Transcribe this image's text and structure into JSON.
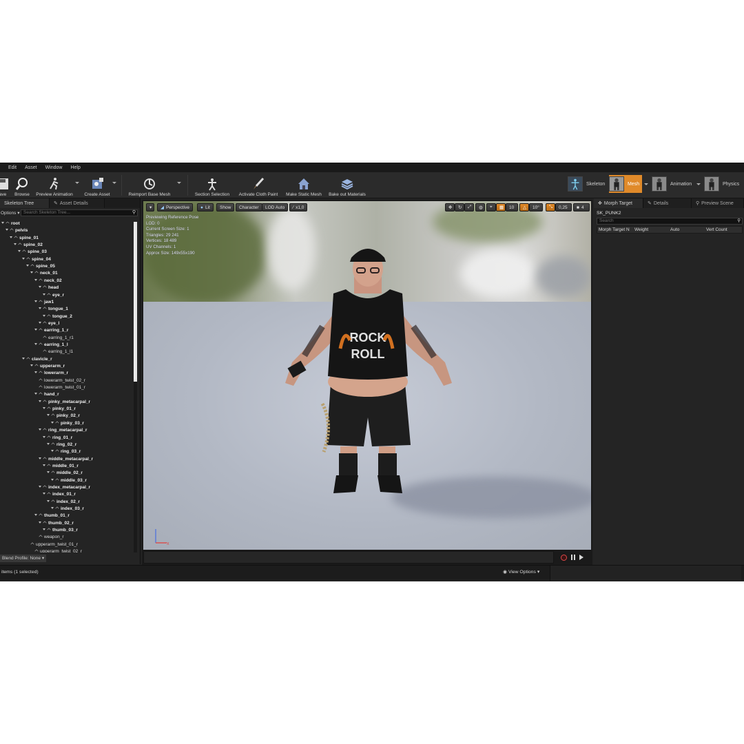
{
  "menu": [
    "Edit",
    "Asset",
    "Window",
    "Help"
  ],
  "toolbar": {
    "buttons": [
      {
        "label": "ave",
        "icon": "save-icon"
      },
      {
        "label": "Browse",
        "icon": "browse-icon"
      },
      {
        "label": "Preview Animation",
        "icon": "running-figure-icon"
      },
      {
        "label": "Create Asset",
        "icon": "create-asset-icon"
      },
      {
        "label": "Reimport Base Mesh",
        "icon": "reimport-icon"
      },
      {
        "label": "Section Selection",
        "icon": "section-selection-icon"
      },
      {
        "label": "Activate Cloth Paint",
        "icon": "brush-icon"
      },
      {
        "label": "Make Static Mesh",
        "icon": "house-icon"
      },
      {
        "label": "Bake out Materials",
        "icon": "layers-icon"
      }
    ],
    "modes": [
      {
        "label": "Skeleton"
      },
      {
        "label": "Mesh",
        "active": true
      },
      {
        "label": "Animation"
      },
      {
        "label": "Physics"
      }
    ]
  },
  "left_panel": {
    "tabs": [
      "Skeleton Tree",
      "Asset Details"
    ],
    "options_label": "Options",
    "search_placeholder": "Search Skeleton Tree...",
    "blend_profile": "Blend Profile: None",
    "bones": [
      {
        "name": "root",
        "bold": true
      },
      {
        "name": "pelvis",
        "bold": true
      },
      {
        "name": "spine_01",
        "bold": true
      },
      {
        "name": "spine_02",
        "bold": true
      },
      {
        "name": "spine_03",
        "bold": true
      },
      {
        "name": "spine_04",
        "bold": true
      },
      {
        "name": "spine_05",
        "bold": true
      },
      {
        "name": "neck_01",
        "bold": true
      },
      {
        "name": "neck_02",
        "bold": true
      },
      {
        "name": "head",
        "bold": true
      },
      {
        "name": "eye_r",
        "bold": true
      },
      {
        "name": "jaw1",
        "bold": true
      },
      {
        "name": "tongue_1",
        "bold": true
      },
      {
        "name": "tongue_2",
        "bold": true
      },
      {
        "name": "eye_l",
        "bold": true
      },
      {
        "name": "earring_1_r",
        "bold": true
      },
      {
        "name": "earring_1_r1",
        "bold": false
      },
      {
        "name": "earring_1_l",
        "bold": true
      },
      {
        "name": "earring_1_l1",
        "bold": false
      },
      {
        "name": "clavicle_r",
        "bold": true
      },
      {
        "name": "upperarm_r",
        "bold": true
      },
      {
        "name": "lowerarm_r",
        "bold": true
      },
      {
        "name": "lowerarm_twist_02_r",
        "bold": false
      },
      {
        "name": "lowerarm_twist_01_r",
        "bold": false
      },
      {
        "name": "hand_r",
        "bold": true
      },
      {
        "name": "pinky_metacarpal_r",
        "bold": true
      },
      {
        "name": "pinky_01_r",
        "bold": true
      },
      {
        "name": "pinky_02_r",
        "bold": true
      },
      {
        "name": "pinky_03_r",
        "bold": true
      },
      {
        "name": "ring_metacarpal_r",
        "bold": true
      },
      {
        "name": "ring_01_r",
        "bold": true
      },
      {
        "name": "ring_02_r",
        "bold": true
      },
      {
        "name": "ring_03_r",
        "bold": true
      },
      {
        "name": "middle_metacarpal_r",
        "bold": true
      },
      {
        "name": "middle_01_r",
        "bold": true
      },
      {
        "name": "middle_02_r",
        "bold": true
      },
      {
        "name": "middle_03_r",
        "bold": true
      },
      {
        "name": "index_metacarpal_r",
        "bold": true
      },
      {
        "name": "index_01_r",
        "bold": true
      },
      {
        "name": "index_02_r",
        "bold": true
      },
      {
        "name": "index_03_r",
        "bold": true
      },
      {
        "name": "thumb_01_r",
        "bold": true
      },
      {
        "name": "thumb_02_r",
        "bold": true
      },
      {
        "name": "thumb_03_r",
        "bold": true
      },
      {
        "name": "weapon_r",
        "bold": false
      },
      {
        "name": "upperarm_twist_01_r",
        "bold": false
      },
      {
        "name": "upperarm_twist_02_r",
        "bold": false
      }
    ]
  },
  "viewport": {
    "buttons": {
      "perspective": "Perspective",
      "lit": "Lit",
      "show": "Show",
      "character": "Character",
      "lod": "LOD Auto",
      "speed": "x1,0",
      "grid": "10",
      "angle": "10°",
      "scale": "0,25",
      "camera": "4"
    },
    "info": [
      "Previewing Reference Pose",
      "LOD: 0",
      "Current Screen Size: 1",
      "Triangles: 29 241",
      "Vertices: 18 489",
      "UV Channels: 1",
      "Approx Size: 149x55x190"
    ]
  },
  "right_panel": {
    "tabs": [
      "Morph Target",
      "Details",
      "Preview Scene"
    ],
    "asset_name": "SK_PUNK2",
    "search_placeholder": "Search",
    "columns": [
      "Morph Target N",
      "Weight",
      "Auto",
      "Vert Count"
    ]
  },
  "status": {
    "items_text": "items (1 selected)",
    "view_options": "View Options"
  },
  "colors": {
    "accent": "#e08a2a",
    "panel": "#242424",
    "toolbar": "#2b2b2b"
  }
}
